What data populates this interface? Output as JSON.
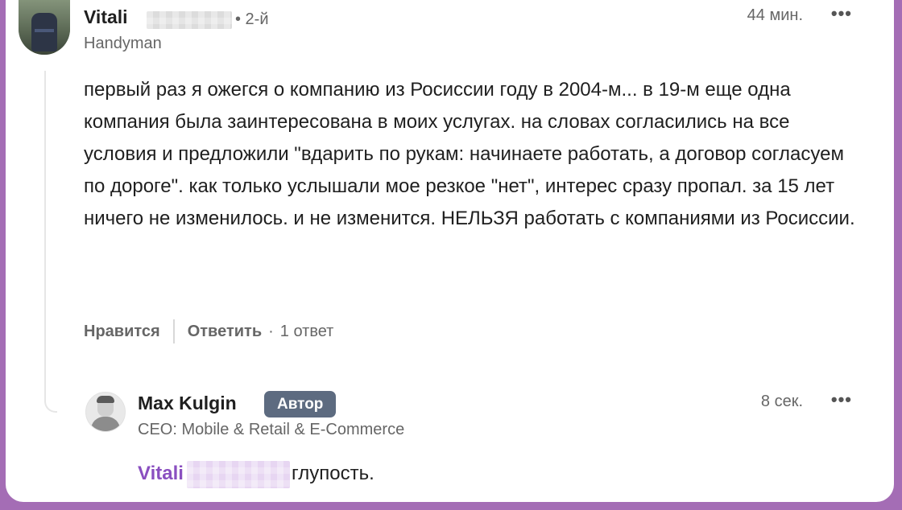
{
  "comment": {
    "author_name": "Vitali",
    "degree": "• 2-й",
    "headline": "Handyman",
    "time": "44 мин.",
    "more_label": "•••",
    "text": "первый раз я ожегся о компанию из Росиссии году в 2004-м... в 19-м еще одна компания была заинтересована в моих услугах. на словах согласились на все условия и предложили \"вдарить по рукам: начинаете работать, а договор согласуем по дороге\". как только услышали мое резкое \"нет\", интерес сразу пропал. за 15 лет ничего не изменилось. и не изменится. НЕЛЬЗЯ работать с компаниями из Росиссии.",
    "actions": {
      "like": "Нравится",
      "reply": "Ответить",
      "dot": "·",
      "replies_count": "1 ответ"
    }
  },
  "reply": {
    "author_name": "Max Kulgin",
    "badge": "Автор",
    "headline": "CEO: Mobile & Retail & E-Commerce",
    "time": "8 сек.",
    "more_label": "•••",
    "mention": "Vitali",
    "text": "глупость."
  },
  "colors": {
    "frame_border": "#a46db5",
    "mention": "#8a4fc0",
    "badge_bg": "#5d6b80",
    "secondary_text": "#666666"
  }
}
